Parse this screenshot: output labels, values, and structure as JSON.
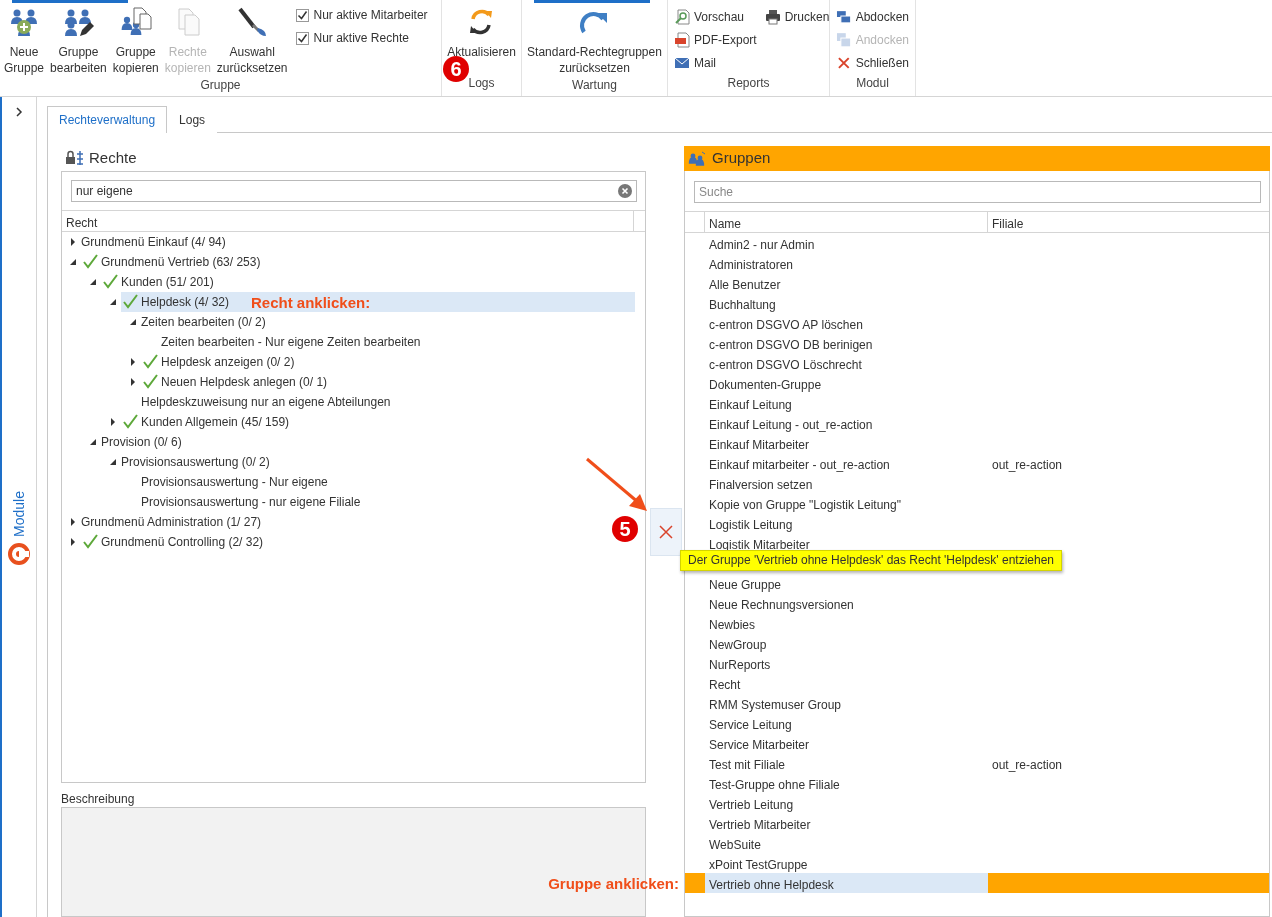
{
  "ribbon": {
    "groups": [
      {
        "label": "Gruppe",
        "accent": true,
        "items": [
          {
            "kind": "large",
            "lines": [
              "Neue",
              "Gruppe"
            ],
            "disabled": false
          },
          {
            "kind": "large",
            "lines": [
              "Gruppe",
              "bearbeiten"
            ],
            "disabled": false
          },
          {
            "kind": "large",
            "lines": [
              "Gruppe",
              "kopieren"
            ],
            "disabled": false
          },
          {
            "kind": "large",
            "lines": [
              "Rechte",
              "kopieren"
            ],
            "disabled": true
          },
          {
            "kind": "large",
            "lines": [
              "Auswahl",
              "zurücksetzen"
            ],
            "disabled": false
          },
          {
            "kind": "check",
            "label": "Nur aktive Mitarbeiter",
            "checked": true
          },
          {
            "kind": "check",
            "label": "Nur aktive Rechte",
            "checked": true
          }
        ]
      },
      {
        "label": "Logs",
        "accent": false,
        "badge": "6",
        "items": [
          {
            "kind": "large",
            "lines": [
              "Aktualisieren"
            ],
            "disabled": false
          }
        ]
      },
      {
        "label": "Wartung",
        "accent": true,
        "items": [
          {
            "kind": "large",
            "lines": [
              "Standard-Rechtegruppen",
              "zurücksetzen"
            ],
            "disabled": false
          }
        ]
      },
      {
        "label": "Reports",
        "accent": false,
        "items": [
          {
            "kind": "small",
            "label": "Vorschau",
            "disabled": false
          },
          {
            "kind": "small",
            "label": "PDF-Export",
            "disabled": false
          },
          {
            "kind": "small",
            "label": "Mail",
            "disabled": false
          },
          {
            "kind": "small",
            "label": "Drucken",
            "disabled": false
          }
        ]
      },
      {
        "label": "Modul",
        "accent": false,
        "items": [
          {
            "kind": "small",
            "label": "Abdocken",
            "disabled": false
          },
          {
            "kind": "small",
            "label": "Andocken",
            "disabled": true
          },
          {
            "kind": "small",
            "label": "Schließen",
            "disabled": false
          }
        ]
      }
    ]
  },
  "sidebar": {
    "label": "Module"
  },
  "tabs": [
    {
      "label": "Rechteverwaltung",
      "selected": true
    },
    {
      "label": "Logs",
      "selected": false
    }
  ],
  "rights": {
    "title": "Rechte",
    "search": {
      "value": "nur eigene"
    },
    "column": "Recht",
    "annotation": "Recht anklicken:",
    "tree": [
      {
        "label": "Grundmenü Einkauf (4/ 94)",
        "checked": false,
        "selected": false,
        "expanded": false
      },
      {
        "label": "Grundmenü Vertrieb (63/ 253)",
        "checked": true,
        "selected": false,
        "expanded": true,
        "children": [
          {
            "label": "Kunden (51/ 201)",
            "checked": true,
            "selected": false,
            "expanded": true,
            "children": [
              {
                "label": "Helpdesk (4/ 32)",
                "checked": true,
                "selected": true,
                "expanded": true,
                "children": [
                  {
                    "label": "Zeiten bearbeiten (0/ 2)",
                    "checked": false,
                    "selected": false,
                    "expanded": true,
                    "children": [
                      {
                        "label": "Zeiten bearbeiten - Nur eigene Zeiten bearbeiten",
                        "checked": false,
                        "selected": false
                      }
                    ]
                  },
                  {
                    "label": "Helpdesk anzeigen (0/ 2)",
                    "checked": true,
                    "selected": false,
                    "expanded": false
                  },
                  {
                    "label": "Neuen Helpdesk anlegen (0/ 1)",
                    "checked": true,
                    "selected": false,
                    "expanded": false
                  },
                  {
                    "label": "Helpdeskzuweisung nur an eigene Abteilungen",
                    "checked": false,
                    "selected": false
                  }
                ]
              },
              {
                "label": "Kunden Allgemein (45/ 159)",
                "checked": true,
                "selected": false,
                "expanded": false
              }
            ]
          },
          {
            "label": "Provision (0/ 6)",
            "checked": false,
            "selected": false,
            "expanded": true,
            "children": [
              {
                "label": "Provisionsauswertung (0/ 2)",
                "checked": false,
                "selected": false,
                "expanded": true,
                "children": [
                  {
                    "label": "Provisionsauswertung - Nur eigene",
                    "checked": false,
                    "selected": false
                  },
                  {
                    "label": "Provisionsauswertung - nur eigene Filiale",
                    "checked": false,
                    "selected": false
                  }
                ]
              }
            ]
          }
        ]
      },
      {
        "label": "Grundmenü Administration (1/ 27)",
        "checked": false,
        "selected": false,
        "expanded": false
      },
      {
        "label": "Grundmenü Controlling (2/ 32)",
        "checked": true,
        "selected": false,
        "expanded": false
      }
    ]
  },
  "description": {
    "label": "Beschreibung"
  },
  "remove_button": {
    "badge": "5",
    "tooltip": "Der Gruppe 'Vertrieb ohne Helpdesk' das Recht 'Helpdesk' entziehen"
  },
  "groups": {
    "title": "Gruppen",
    "search": {
      "placeholder": "Suche"
    },
    "columns": [
      "Name",
      "Filiale"
    ],
    "annotation": "Gruppe anklicken:",
    "rows": [
      {
        "kind": "row",
        "name": "Admin2 - nur Admin",
        "selected": false
      },
      {
        "kind": "row",
        "name": "Administratoren",
        "selected": false
      },
      {
        "kind": "row",
        "name": "Alle Benutzer",
        "selected": false
      },
      {
        "kind": "row",
        "name": "Buchhaltung",
        "selected": false
      },
      {
        "kind": "row",
        "name": "c-entron DSGVO AP löschen",
        "selected": false
      },
      {
        "kind": "row",
        "name": "c-entron DSGVO DB berinigen",
        "selected": false
      },
      {
        "kind": "row",
        "name": "c-entron DSGVO Löschrecht",
        "selected": false
      },
      {
        "kind": "row",
        "name": "Dokumenten-Gruppe",
        "selected": false
      },
      {
        "kind": "row",
        "name": "Einkauf Leitung",
        "selected": false
      },
      {
        "kind": "row",
        "name": "Einkauf Leitung - out_re-action",
        "selected": false
      },
      {
        "kind": "row",
        "name": "Einkauf Mitarbeiter",
        "selected": false
      },
      {
        "kind": "row",
        "name": "Einkauf mitarbeiter - out_re-action",
        "filiale": "out_re-action",
        "selected": false
      },
      {
        "kind": "row",
        "name": "Finalversion setzen",
        "selected": false
      },
      {
        "kind": "row",
        "name": "Kopie von Gruppe \"Logistik Leitung\"",
        "selected": false
      },
      {
        "kind": "row",
        "name": "Logistik Leitung",
        "selected": false
      },
      {
        "kind": "row",
        "name": "Logistik Mitarbeiter",
        "selected": false
      },
      {
        "kind": "covered"
      },
      {
        "kind": "row",
        "name": "Neue Gruppe",
        "selected": false
      },
      {
        "kind": "row",
        "name": "Neue Rechnungsversionen",
        "selected": false
      },
      {
        "kind": "row",
        "name": "Newbies",
        "selected": false
      },
      {
        "kind": "row",
        "name": "NewGroup",
        "selected": false
      },
      {
        "kind": "row",
        "name": "NurReports",
        "selected": false
      },
      {
        "kind": "row",
        "name": "Recht",
        "selected": false
      },
      {
        "kind": "row",
        "name": "RMM Systemuser Group",
        "selected": false
      },
      {
        "kind": "row",
        "name": "Service Leitung",
        "selected": false
      },
      {
        "kind": "row",
        "name": "Service Mitarbeiter",
        "selected": false
      },
      {
        "kind": "row",
        "name": "Test mit Filiale",
        "filiale": "out_re-action",
        "selected": false
      },
      {
        "kind": "row",
        "name": "Test-Gruppe ohne Filiale",
        "selected": false
      },
      {
        "kind": "row",
        "name": "Vertrieb Leitung",
        "selected": false
      },
      {
        "kind": "row",
        "name": "Vertrieb Mitarbeiter",
        "selected": false
      },
      {
        "kind": "row",
        "name": "WebSuite",
        "selected": false
      },
      {
        "kind": "row",
        "name": "xPoint TestGruppe",
        "selected": false
      },
      {
        "kind": "row",
        "name": "Vertrieb ohne Helpdesk",
        "selected": true
      }
    ]
  }
}
